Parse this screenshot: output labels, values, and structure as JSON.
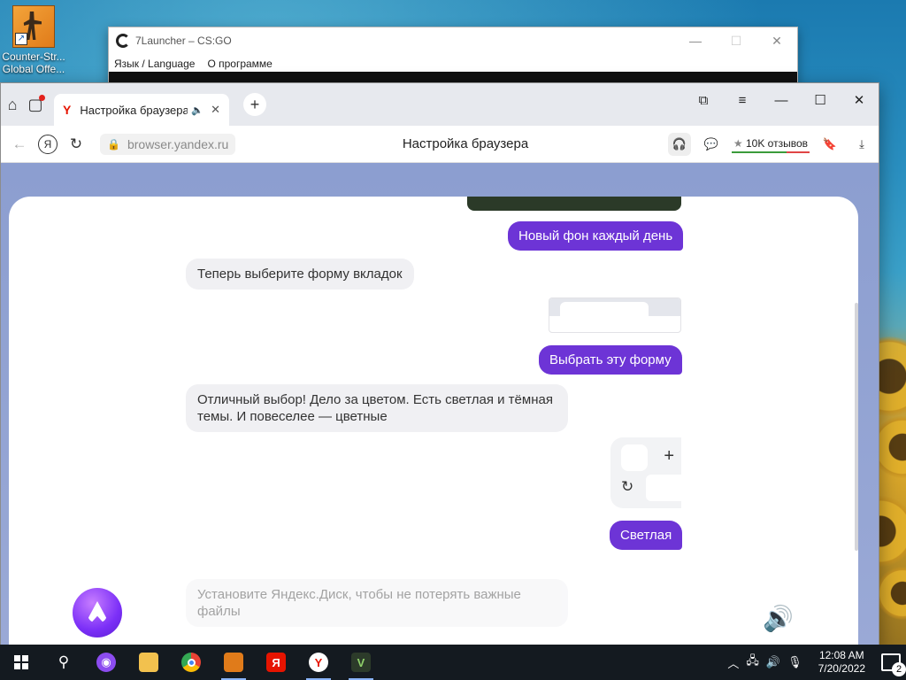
{
  "desktop": {
    "icon_label": "Counter-Str... Global Offe..."
  },
  "launcher": {
    "title": "7Launcher – CS:GO",
    "menu": [
      "Язык / Language",
      "О программе"
    ]
  },
  "browser": {
    "tab_title": "Настройка браузера",
    "url": "browser.yandex.ru",
    "page_title": "Настройка браузера",
    "reviews": "10K отзывов"
  },
  "chat": {
    "msg_new_bg": "Новый фон каждый день",
    "msg_choose_tab_shape": "Теперь выберите форму вкладок",
    "msg_choose_shape_btn": "Выбрать эту форму",
    "msg_great_choice": "Отличный выбор! Дело за цветом. Есть светлая и тёмная темы. И повеселее — цветные",
    "msg_light": "Светлая",
    "msg_install_disk": "Установите Яндекс.Диск, чтобы не потерять важные файлы"
  },
  "taskbar": {
    "time": "12:08 AM",
    "date": "7/20/2022",
    "notifications": "2"
  },
  "colors": {
    "accent": "#6d34d6",
    "taskbar": "#141a20"
  }
}
